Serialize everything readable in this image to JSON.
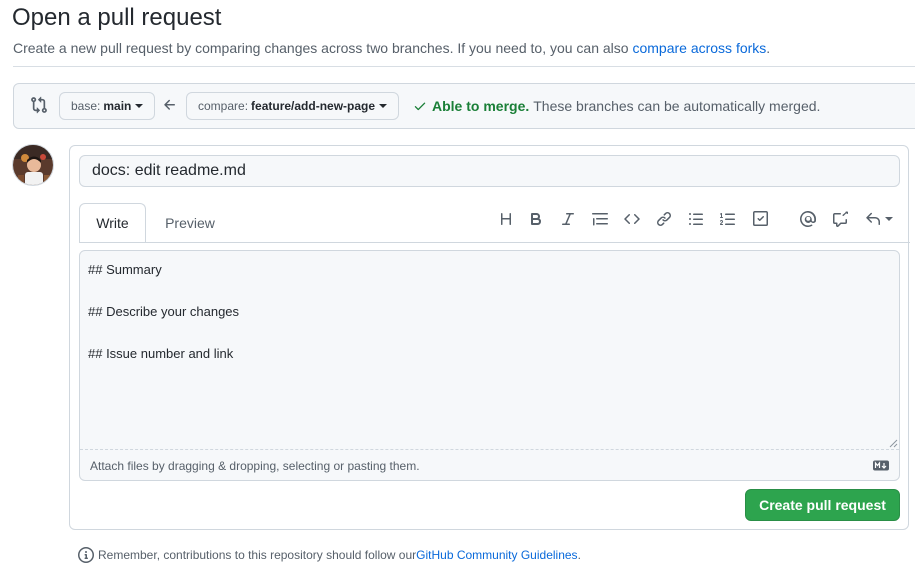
{
  "page": {
    "title": "Open a pull request",
    "subtitle_text": "Create a new pull request by comparing changes across two branches. If you need to, you can also ",
    "subtitle_link": "compare across forks",
    "subtitle_end": "."
  },
  "range": {
    "base_prefix": "base:",
    "base_branch": "main",
    "compare_prefix": "compare:",
    "compare_branch": "feature/add-new-page",
    "merge_ok": "Able to merge.",
    "merge_text": "These branches can be automatically merged."
  },
  "form": {
    "title_value": "docs: edit readme.md",
    "tabs": {
      "write": "Write",
      "preview": "Preview"
    },
    "toolbar_icons": [
      "heading-icon",
      "bold-icon",
      "italic-icon",
      "quote-icon",
      "code-icon",
      "link-icon",
      "unordered-list-icon",
      "ordered-list-icon",
      "task-list-icon",
      "mention-icon",
      "reference-icon",
      "reply-icon"
    ],
    "body": "## Summary\n\n## Describe your changes\n\n## Issue number and link",
    "attach_text": "Attach files by dragging & dropping, selecting or pasting them.",
    "submit_label": "Create pull request"
  },
  "footer": {
    "note_text": "Remember, contributions to this repository should follow our ",
    "note_link": "GitHub Community Guidelines",
    "note_end": "."
  },
  "colors": {
    "accent": "#0969da",
    "success": "#1a7f37",
    "button_green": "#2da44e",
    "border": "#d0d7de",
    "muted": "#57606a"
  }
}
